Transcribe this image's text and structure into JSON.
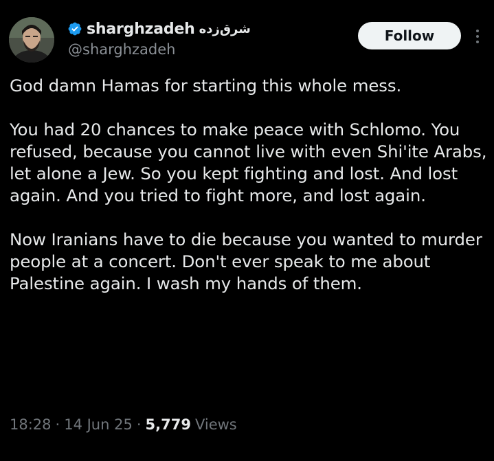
{
  "author": {
    "display_name": "sharghzadeh",
    "display_name_extra": "شرق‌زده",
    "handle": "@sharghzadeh",
    "verified": true,
    "avatar_icon": "avatar-photo"
  },
  "actions": {
    "follow_label": "Follow",
    "more_icon": "more-options-icon"
  },
  "tweet": {
    "paragraphs": [
      "God damn Hamas for starting this whole mess.",
      "You had 20 chances to make peace with Schlomo. You refused, because you cannot live with even Shi'ite Arabs, let alone a Jew. So you kept fighting and lost. And lost again. And you tried to fight more, and lost again.",
      "Now Iranians have to die because you wanted to murder people at a concert. Don't ever speak to me about Palestine again. I wash my hands of them."
    ]
  },
  "meta": {
    "time": "18:28",
    "separator": "·",
    "date": "14 Jun 25",
    "views_count": "5,779",
    "views_label": "Views"
  },
  "colors": {
    "background": "#000000",
    "text": "#e7e9ea",
    "secondary_text": "#71767b",
    "verified_badge": "#1d9bf0",
    "follow_bg": "#eff3f4"
  }
}
